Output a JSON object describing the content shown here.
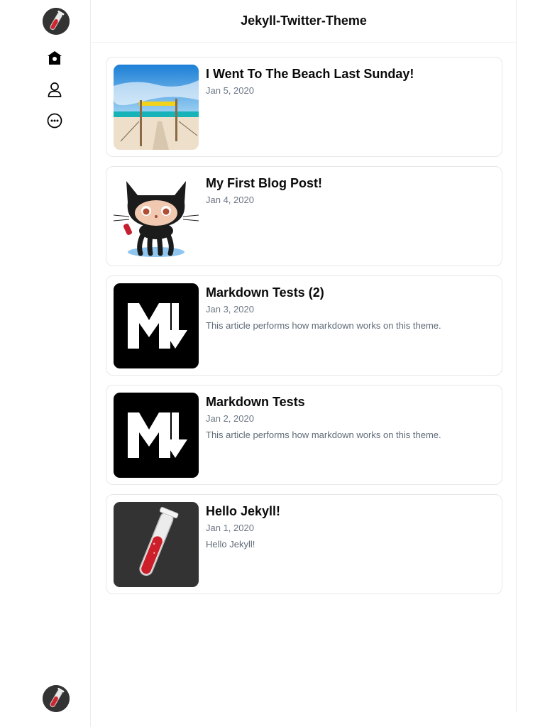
{
  "header": {
    "title": "Jekyll-Twitter-Theme"
  },
  "sidebar": {
    "logo_icon": "test-tube-avatar",
    "nav": [
      {
        "name": "home",
        "icon": "home-icon"
      },
      {
        "name": "profile",
        "icon": "user-icon"
      },
      {
        "name": "more",
        "icon": "more-icon"
      }
    ]
  },
  "posts": [
    {
      "title": "I Went To The Beach Last Sunday!",
      "date": "Jan 5, 2020",
      "excerpt": "",
      "thumbnail": "beach-photo"
    },
    {
      "title": "My First Blog Post!",
      "date": "Jan 4, 2020",
      "excerpt": "",
      "thumbnail": "octocat-image"
    },
    {
      "title": "Markdown Tests (2)",
      "date": "Jan 3, 2020",
      "excerpt": "This article performs how markdown works on this theme.",
      "thumbnail": "markdown-logo"
    },
    {
      "title": "Markdown Tests",
      "date": "Jan 2, 2020",
      "excerpt": "This article performs how markdown works on this theme.",
      "thumbnail": "markdown-logo"
    },
    {
      "title": "Hello Jekyll!",
      "date": "Jan 1, 2020",
      "excerpt": "Hello Jekyll!",
      "thumbnail": "test-tube-image"
    }
  ]
}
